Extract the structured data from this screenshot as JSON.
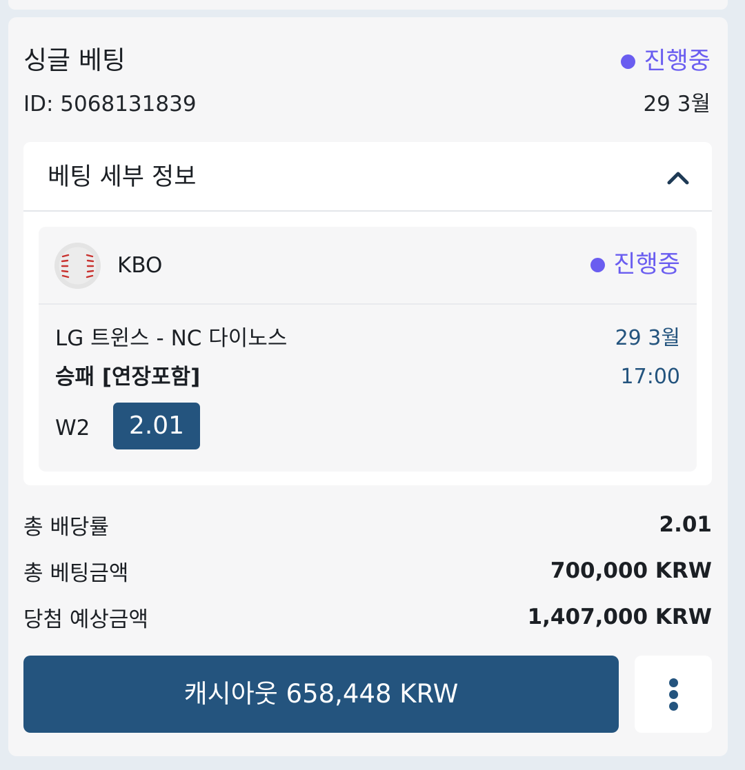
{
  "bet": {
    "title": "싱글 베팅",
    "status": "진행중",
    "id_label": "ID: 5068131839",
    "date": "29 3월"
  },
  "details": {
    "title": "베팅 세부 정보",
    "expanded": true
  },
  "event": {
    "league": "KBO",
    "status": "진행중",
    "match": "LG 트윈스 - NC 다이노스",
    "market": "승패 [연장포함]",
    "date": "29 3월",
    "time": "17:00",
    "pick": "W2",
    "odds": "2.01"
  },
  "summary": [
    {
      "label": "총 배당률",
      "value": "2.01"
    },
    {
      "label": "총 베팅금액",
      "value": "700,000 KRW"
    },
    {
      "label": "당첨 예상금액",
      "value": "1,407,000 KRW"
    }
  ],
  "actions": {
    "cashout_label": "캐시아웃 658,448 KRW",
    "more_icon": "vertical-dots-icon"
  },
  "colors": {
    "accent": "#24547e",
    "status": "#6a5df0",
    "background": "#e6ecf2",
    "card": "#f6f6f7"
  }
}
